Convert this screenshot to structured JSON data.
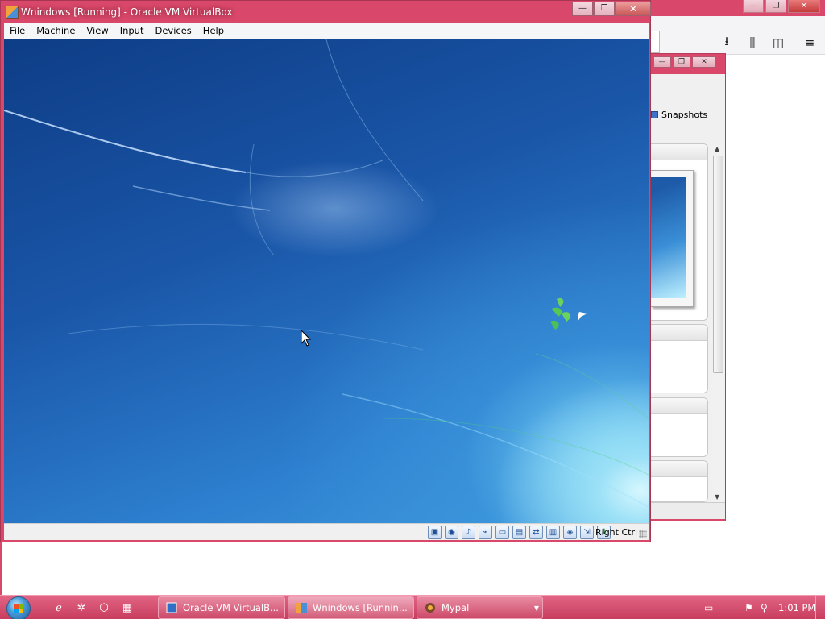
{
  "vm_window": {
    "title": "Wnindows  [Running] - Oracle VM VirtualBox",
    "menu": [
      "File",
      "Machine",
      "View",
      "Input",
      "Devices",
      "Help"
    ],
    "caption": {
      "minimize": "—",
      "restore": "❐",
      "close": "✕"
    },
    "status": {
      "icons": [
        "hard-disk-icon",
        "optical-drive-icon",
        "audio-icon",
        "usb-icon",
        "shared-folders-icon",
        "display-icon",
        "network-icon",
        "recording-icon",
        "cpu-icon",
        "mouse-integration-icon",
        "keyboard-capture-icon"
      ],
      "host_key": "Right Ctrl"
    }
  },
  "manager_window": {
    "snapshots_label": "Snapshots",
    "caption": {
      "minimize": "—",
      "restore": "❐",
      "close": "✕"
    }
  },
  "browser": {
    "caption": {
      "minimize": "—",
      "restore": "❐",
      "close": "✕"
    },
    "toolbar": {
      "download": "⭳",
      "library": "⫼",
      "sidebar": "◫",
      "menu": "≡"
    }
  },
  "taskbar": {
    "quick_launch": [
      "internet-explorer-icon",
      "tools-icon",
      "virtualbox-icon",
      "windows-explorer-icon"
    ],
    "tasks": [
      {
        "label": "Oracle VM VirtualB...",
        "active": false
      },
      {
        "label": "Wnindows  [Runnin...",
        "active": true
      },
      {
        "label": "Mypal",
        "active": false
      }
    ],
    "clock": "1:01 PM"
  },
  "colors": {
    "window_frame": "#d9486a",
    "taskbar": "#c83d5e",
    "desktop": "#1a56a8"
  }
}
